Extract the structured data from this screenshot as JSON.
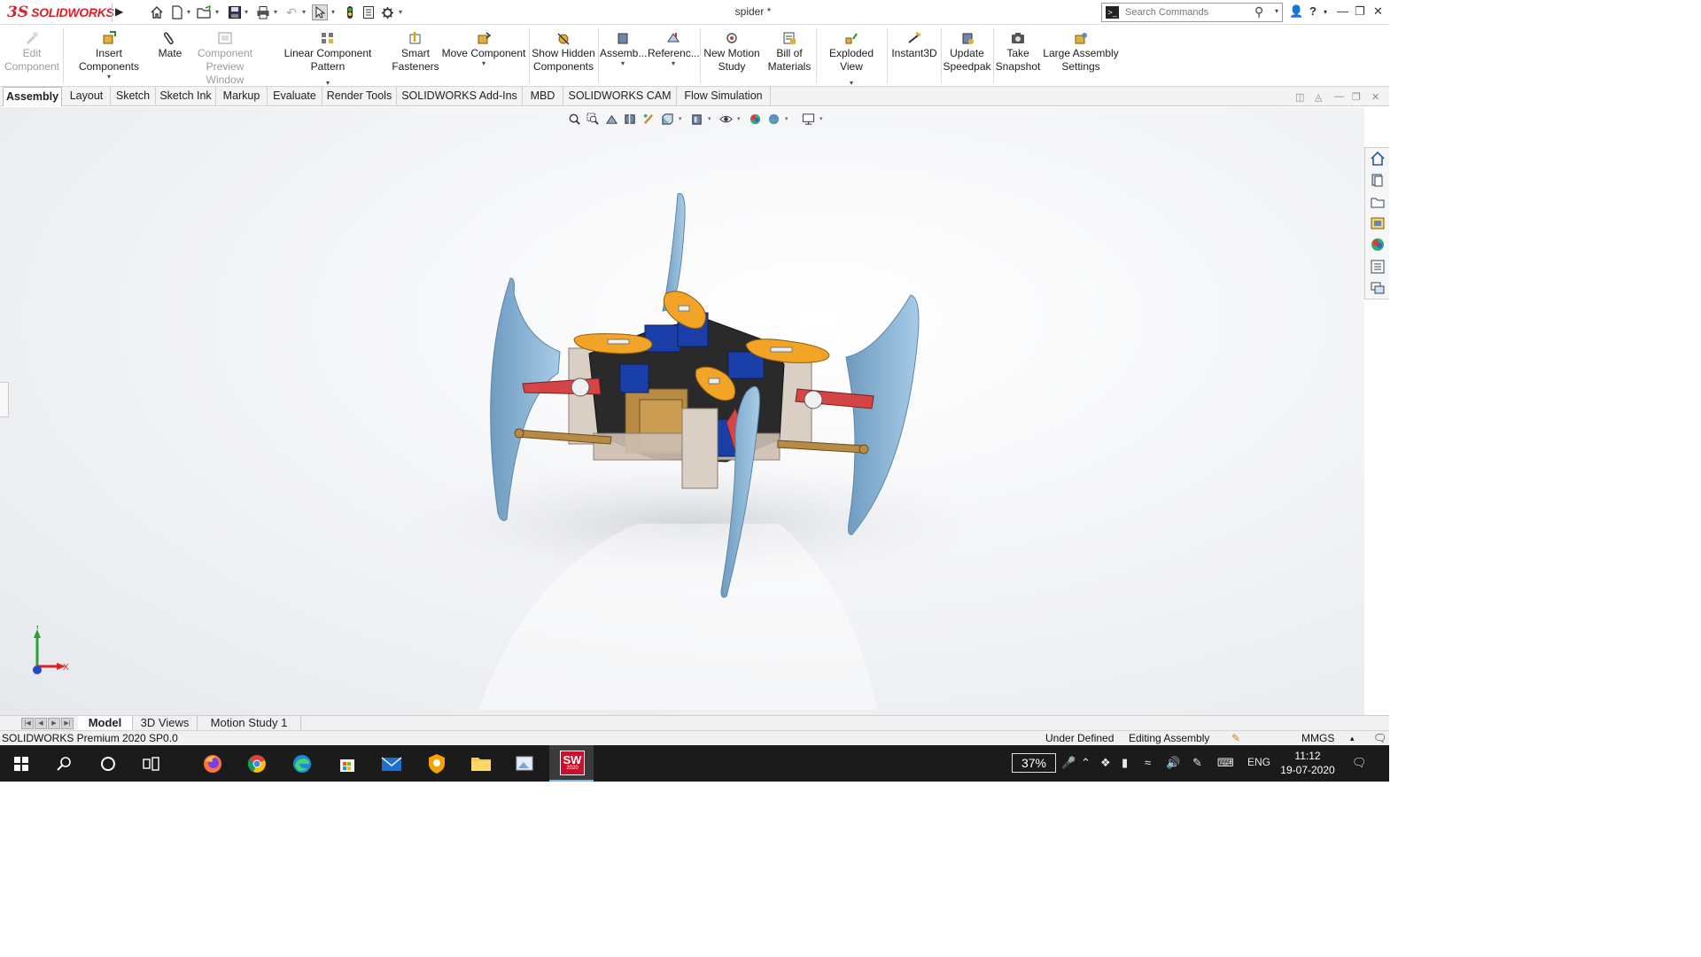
{
  "app": {
    "logo_text": "SOLIDWORKS",
    "document_title": "spider *"
  },
  "search": {
    "placeholder": "Search Commands"
  },
  "ribbon": {
    "edit_component": "Edit Component",
    "insert_components": "Insert Components",
    "mate": "Mate",
    "component_preview": "Component Preview Window",
    "linear_pattern": "Linear Component Pattern",
    "smart_fasteners": "Smart Fasteners",
    "move_component": "Move Component",
    "show_hidden": "Show Hidden Components",
    "assembly_features": "Assemb...",
    "reference_geometry": "Referenc...",
    "new_motion_study": "New Motion Study",
    "bill_of_materials": "Bill of Materials",
    "exploded_view": "Exploded View",
    "instant3d": "Instant3D",
    "update_speedpak": "Update Speedpak",
    "take_snapshot": "Take Snapshot",
    "large_assembly": "Large Assembly Settings"
  },
  "tabs": [
    "Assembly",
    "Layout",
    "Sketch",
    "Sketch Ink",
    "Markup",
    "Evaluate",
    "Render Tools",
    "SOLIDWORKS Add-Ins",
    "MBD",
    "SOLIDWORKS CAM",
    "Flow Simulation"
  ],
  "bottom_tabs": [
    "Model",
    "3D Views",
    "Motion Study 1"
  ],
  "triad": {
    "y": "Y",
    "x": "X"
  },
  "status": {
    "product": "SOLIDWORKS Premium 2020 SP0.0",
    "definition": "Under Defined",
    "mode": "Editing Assembly",
    "units": "MMGS",
    "units_arrow": "▴"
  },
  "taskbar": {
    "battery": "37%",
    "language": "ENG",
    "time": "11:12",
    "date": "19-07-2020",
    "sw_badge": "SW",
    "sw_year": "2020"
  },
  "colors": {
    "brand_red": "#d8202b",
    "leg_blue": "#8fb8d8",
    "horn_orange": "#f2a427",
    "servo_blue": "#1b3fa8",
    "arm_red": "#d64545",
    "wood": "#b78b44"
  }
}
